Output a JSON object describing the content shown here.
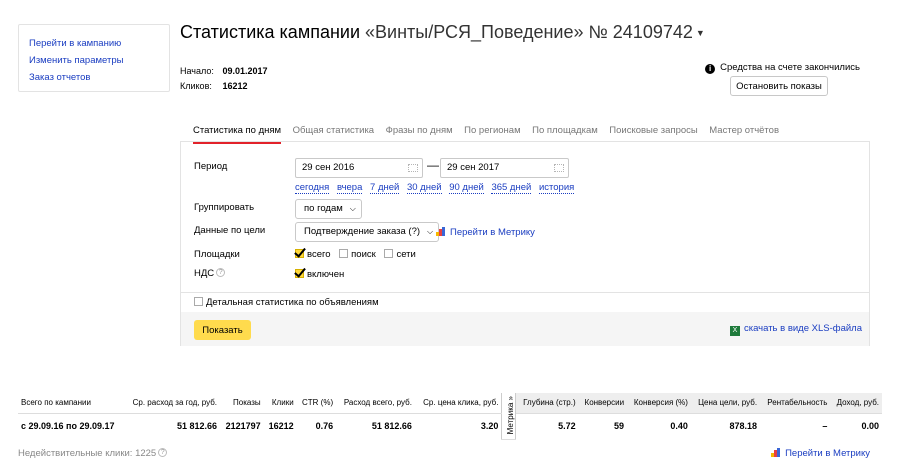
{
  "left_menu": {
    "items": [
      "Перейти в кампанию",
      "Изменить параметры",
      "Заказ отчетов"
    ]
  },
  "header": {
    "title_prefix": "Статистика кампании",
    "campaign_name": "«Винты/РСЯ_Поведение» № 24109742",
    "start_label": "Начало:",
    "start_value": "09.01.2017",
    "clicks_label": "Кликов:",
    "clicks_value": "16212"
  },
  "notice": {
    "text": "Средства на счете закончились",
    "stop_button": "Остановить показы"
  },
  "tabs": [
    "Статистика по дням",
    "Общая статистика",
    "Фразы по дням",
    "По регионам",
    "По площадкам",
    "Поисковые запросы",
    "Мастер отчётов"
  ],
  "active_tab": 0,
  "filters": {
    "period_label": "Период",
    "date_from": "29 сен 2016",
    "date_to": "29 сен 2017",
    "quick_periods": [
      "сегодня",
      "вчера",
      "7 дней",
      "30 дней",
      "90 дней",
      "365 дней",
      "история"
    ],
    "group_label": "Группировать",
    "group_value": "по годам",
    "goal_label": "Данные по цели",
    "goal_value": "Подтверждение заказа (?)",
    "metrika_link": "Перейти в Метрику",
    "places_label": "Площадки",
    "places": [
      {
        "label": "всего",
        "checked": true
      },
      {
        "label": "поиск",
        "checked": false
      },
      {
        "label": "сети",
        "checked": false
      }
    ],
    "vat_label": "НДС",
    "vat_help": "?",
    "vat_option": {
      "label": "включен",
      "checked": true
    },
    "detail_option": {
      "label": "Детальная статистика по объявлениям",
      "checked": false
    },
    "show_button": "Показать",
    "xls_link": "скачать в виде XLS-файла"
  },
  "stats_table": {
    "headers": [
      "Всего по кампании",
      "Ср. расход за год, руб.",
      "Показы",
      "Клики",
      "CTR (%)",
      "Расход всего, руб.",
      "Ср. цена клика, руб."
    ],
    "metrika_label": "Метрика »",
    "headers_gray": [
      "Глубина (стр.)",
      "Конверсии",
      "Конверсия (%)",
      "Цена цели, руб.",
      "Рентабельность",
      "Доход, руб."
    ],
    "row": [
      "с 29.09.16 по 29.09.17",
      "51 812.66",
      "2121797",
      "16212",
      "0.76",
      "51 812.66",
      "3.20"
    ],
    "row_gray": [
      "5.72",
      "59",
      "0.40",
      "878.18",
      "–",
      "0.00"
    ]
  },
  "footer": {
    "invalid_clicks": "Недействительные клики: 1225",
    "invalid_help": "?",
    "metrika_link": "Перейти в Метрику"
  },
  "colors": {
    "link": "#1a3dc1",
    "accent_button": "#ffdb4d",
    "active_tab_underline": "#e2222a"
  }
}
